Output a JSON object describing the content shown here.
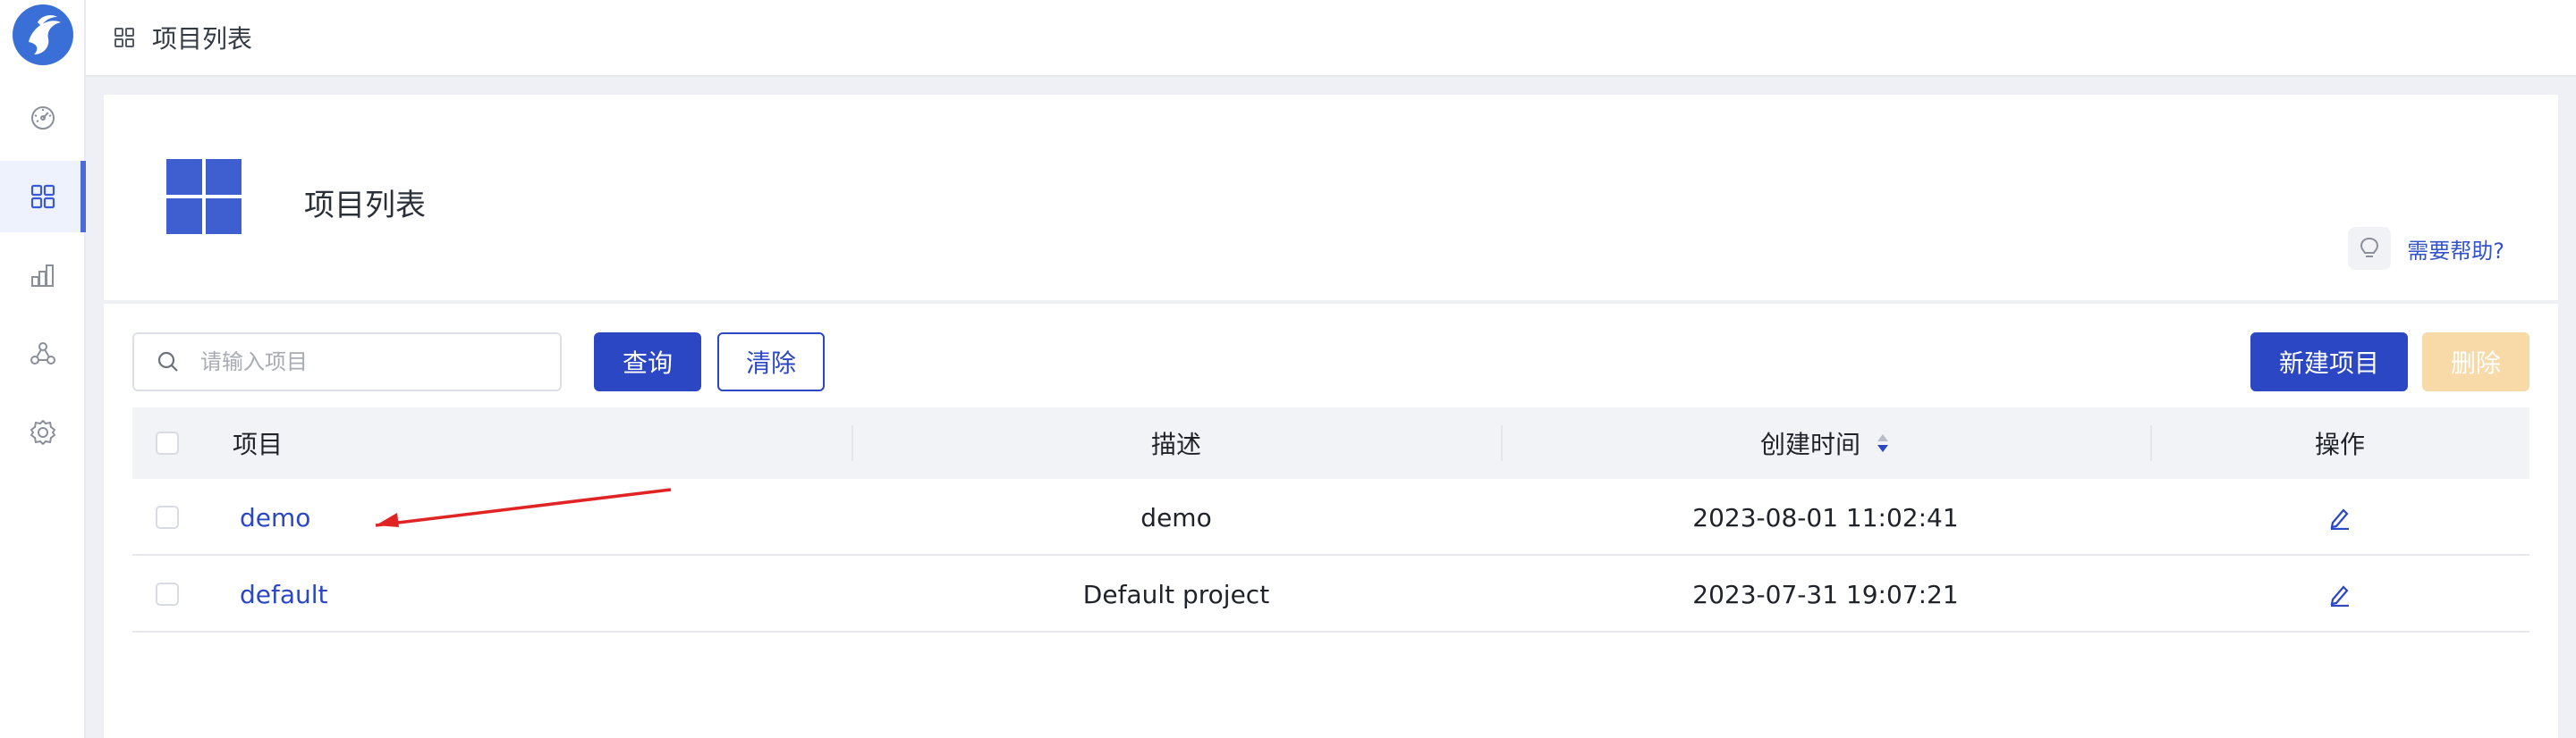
{
  "sidebar": {
    "items": [
      {
        "icon": "dashboard-icon"
      },
      {
        "icon": "grid-icon"
      },
      {
        "icon": "bar-chart-icon"
      },
      {
        "icon": "nodes-icon"
      },
      {
        "icon": "settings-icon"
      }
    ],
    "active_index": 1
  },
  "topbar": {
    "breadcrumb": "项目列表"
  },
  "header": {
    "title": "项目列表",
    "help_link": "需要帮助?"
  },
  "toolbar": {
    "search_placeholder": "请输入项目",
    "search_value": "",
    "query_label": "查询",
    "clear_label": "清除",
    "new_label": "新建项目",
    "delete_label": "删除"
  },
  "table": {
    "columns": {
      "name": "项目",
      "description": "描述",
      "created": "创建时间",
      "actions": "操作"
    },
    "rows": [
      {
        "name": "demo",
        "description": "demo",
        "created": "2023-08-01 11:02:41"
      },
      {
        "name": "default",
        "description": "Default project",
        "created": "2023-07-31 19:07:21"
      }
    ]
  },
  "colors": {
    "accent": "#2b47c4",
    "sidebar_active": "#4a6ad6",
    "disabled_button": "#f8d9a8",
    "annotation_arrow": "#e02424"
  }
}
